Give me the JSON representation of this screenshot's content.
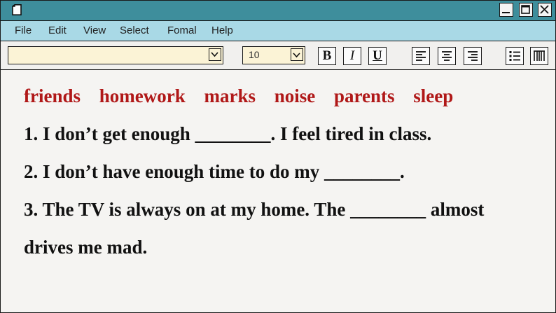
{
  "menu": {
    "items": [
      "File",
      "Edit",
      "View",
      "Select",
      "Fomal",
      "Help"
    ]
  },
  "toolbar": {
    "font_value": "",
    "size_value": "10",
    "bold_label": "B",
    "italic_label": "I",
    "underline_label": "U"
  },
  "document": {
    "word_bank": [
      "friends",
      "homework",
      "marks",
      "noise",
      "parents",
      "sleep"
    ],
    "lines": [
      "1. I don’t get enough ________. I feel tired in class.",
      "2. I don’t have enough time to do my ________.",
      "3. The TV is always on at my home. The ________ almost",
      "drives me mad."
    ]
  },
  "colors": {
    "titlebar": "#3e8e9c",
    "menubar": "#a9d9e6",
    "word_bank": "#b01818",
    "text": "#111111",
    "input_bg": "#fbf3d6"
  },
  "icons": [
    "document-icon",
    "minimize-icon",
    "maximize-icon",
    "close-icon",
    "chevron-down-icon",
    "align-left-icon",
    "align-center-icon",
    "align-right-icon",
    "bullet-list-icon",
    "columns-icon"
  ]
}
